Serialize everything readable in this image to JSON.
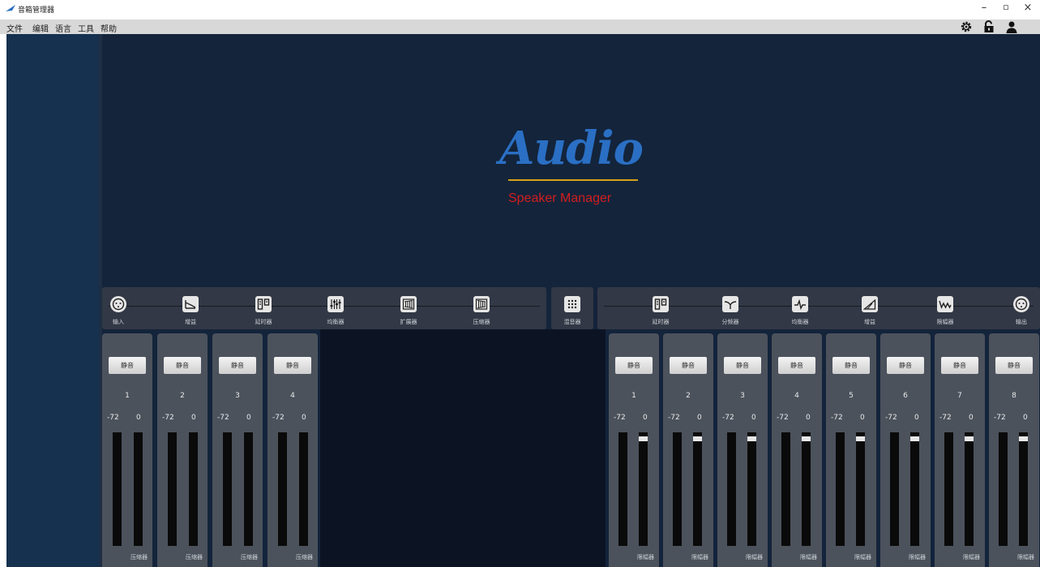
{
  "window": {
    "title": "音箱管理器",
    "minimize": "–",
    "maximize": "▫",
    "close": "×"
  },
  "menu": [
    "文件",
    "编辑",
    "语言",
    "工具",
    "帮助"
  ],
  "toolbar_icons": [
    "gear-icon",
    "unlock-icon",
    "user-icon"
  ],
  "logo": {
    "main": "Audio",
    "sub": "Speaker  Manager",
    "colors": {
      "main": "#2a6fc4",
      "underline": "#d6a21a",
      "sub": "#d31e1e"
    }
  },
  "input_chain": [
    {
      "label": "输入",
      "icon": "input-icon"
    },
    {
      "label": "增益",
      "icon": "gain-icon"
    },
    {
      "label": "延时器",
      "icon": "delay-icon"
    },
    {
      "label": "均衡器",
      "icon": "equalizer-icon"
    },
    {
      "label": "扩展器",
      "icon": "expander-icon"
    },
    {
      "label": "压缩器",
      "icon": "compressor-icon"
    }
  ],
  "mixer": {
    "label": "混音器",
    "icon": "mixer-icon"
  },
  "output_chain": [
    {
      "label": "延时器",
      "icon": "delay-icon"
    },
    {
      "label": "分频器",
      "icon": "crossover-icon"
    },
    {
      "label": "均衡器",
      "icon": "equalizer-icon"
    },
    {
      "label": "增益",
      "icon": "gain-icon"
    },
    {
      "label": "限幅器",
      "icon": "limiter-icon"
    },
    {
      "label": "输出",
      "icon": "output-icon"
    }
  ],
  "input_channels": [
    {
      "mute": "静音",
      "number": "1",
      "min": "-72",
      "max": "0",
      "footer": "压缩器"
    },
    {
      "mute": "静音",
      "number": "2",
      "min": "-72",
      "max": "0",
      "footer": "压缩器"
    },
    {
      "mute": "静音",
      "number": "3",
      "min": "-72",
      "max": "0",
      "footer": "压缩器"
    },
    {
      "mute": "静音",
      "number": "4",
      "min": "-72",
      "max": "0",
      "footer": "压缩器"
    }
  ],
  "output_channels": [
    {
      "mute": "静音",
      "number": "1",
      "min": "-72",
      "max": "0",
      "footer": "限幅器"
    },
    {
      "mute": "静音",
      "number": "2",
      "min": "-72",
      "max": "0",
      "footer": "限幅器"
    },
    {
      "mute": "静音",
      "number": "3",
      "min": "-72",
      "max": "0",
      "footer": "限幅器"
    },
    {
      "mute": "静音",
      "number": "4",
      "min": "-72",
      "max": "0",
      "footer": "限幅器"
    },
    {
      "mute": "静音",
      "number": "5",
      "min": "-72",
      "max": "0",
      "footer": "限幅器"
    },
    {
      "mute": "静音",
      "number": "6",
      "min": "-72",
      "max": "0",
      "footer": "限幅器"
    },
    {
      "mute": "静音",
      "number": "7",
      "min": "-72",
      "max": "0",
      "footer": "限幅器"
    },
    {
      "mute": "静音",
      "number": "8",
      "min": "-72",
      "max": "0",
      "footer": "限幅器"
    }
  ]
}
